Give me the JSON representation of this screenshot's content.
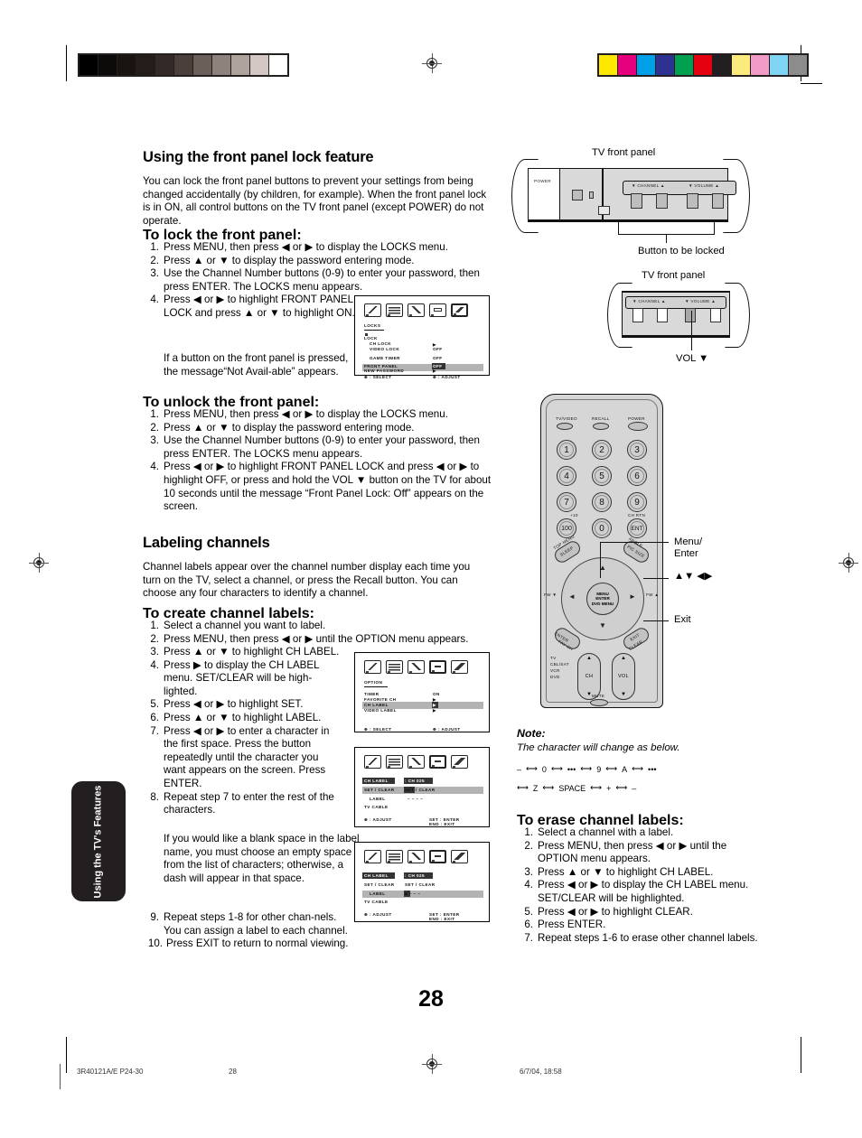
{
  "page": {
    "number": "28",
    "side_tab": "Using the TV's Features",
    "footer": {
      "code": "3R40121A/E P24-30",
      "page": "28",
      "date": "6/7/04, 18:58"
    }
  },
  "colors": {
    "grey_bars": [
      "#000000",
      "#0d0a0a",
      "#191312",
      "#241c1a",
      "#332926",
      "#4a3f3a",
      "#6b5f59",
      "#8d827c",
      "#aea49d",
      "#d3c8c3",
      "#ffffff"
    ],
    "color_bars": [
      "#ffe800",
      "#e6007e",
      "#00a0e9",
      "#2e3192",
      "#00a050",
      "#e3000f",
      "#231f20",
      "#fbea7d",
      "#f39bc8",
      "#7fd4f4",
      "#8c8c8c"
    ],
    "osd_highlight": "#b3b3b3",
    "panel_grey": "#d9d9d9"
  },
  "sections": {
    "front_panel_lock": {
      "heading": "Using the front panel lock feature",
      "intro": "You can lock the front panel buttons to prevent your settings from being changed accidentally (by children, for example). When the front panel lock is in ON, all control buttons on the TV front panel (except POWER) do not operate.",
      "lock_heading": "To lock the front panel:",
      "lock_steps": [
        "Press MENU, then press ◀ or ▶ to display the LOCKS menu.",
        "Press ▲ or ▼ to display the password entering mode.",
        "Use the Channel Number buttons (0-9) to enter your password, then press ENTER. The LOCKS menu appears.",
        "Press ◀ or ▶ to highlight FRONT PANEL LOCK and press ▲ or ▼ to highlight ON."
      ],
      "lock_note": "If a button on the front panel is pressed, the message“Not Avail-able” appears.",
      "unlock_heading": "To unlock the front panel:",
      "unlock_steps": [
        "Press MENU, then press ◀ or ▶ to display the LOCKS menu.",
        "Press ▲ or ▼ to display the password entering mode.",
        "Use the Channel Number buttons (0-9) to enter your password, then press ENTER. The LOCKS menu appears.",
        "Press ◀ or ▶ to highlight FRONT PANEL LOCK and press ◀ or ▶ to highlight OFF, or press and hold the VOL ▼ button on the TV for about 10 seconds until the message “Front Panel Lock: Off” appears on the screen."
      ]
    },
    "labeling_channels": {
      "heading": "Labeling channels",
      "intro": "Channel labels appear over the channel number display each time you turn on the TV, select a channel, or press the Recall button. You can choose any four characters to identify a channel.",
      "create_heading": "To create channel labels:",
      "create_steps": [
        "Select a channel you want to label.",
        "Press MENU, then press ◀ or ▶ until the OPTION menu appears.",
        "Press ▲ or ▼ to highlight CH LABEL.",
        "Press ▶ to display the CH LABEL menu. SET/CLEAR will be high-lighted.",
        "Press ◀ or ▶ to highlight SET.",
        "Press ▲ or ▼ to highlight LABEL.",
        "Press ◀ or ▶ to enter a character in the first space. Press the button repeatedly until the character you want appears on the screen. Press ENTER.",
        "Repeat step 7 to enter the rest of the characters.",
        "Repeat steps 1-8 for other chan-nels. You can assign a label to each channel.",
        "Press EXIT to return to normal viewing."
      ],
      "step8_note": "If you would like a blank space in the label name, you must choose an empty space from the list of characters; otherwise, a dash will appear in that space.",
      "erase_heading": "To erase channel labels:",
      "erase_steps": [
        "Select a channel with a label.",
        "Press MENU, then press ◀ or ▶ until the OPTION menu appears.",
        "Press ▲ or ▼ to highlight CH LABEL.",
        "Press ◀ or ▶ to display the CH LABEL menu. SET/CLEAR will be highlighted.",
        "Press ◀ or ▶ to highlight CLEAR.",
        "Press ENTER.",
        "Repeat steps 1-6 to erase other channel labels."
      ]
    },
    "note": {
      "title": "Note:",
      "text": "The character will change as below.",
      "sequence_row1": [
        "–",
        "0",
        "•••",
        "9",
        "A",
        "•••"
      ],
      "sequence_row2": [
        "Z",
        "SPACE",
        "+",
        "–"
      ]
    }
  },
  "figures": {
    "tv_panel_top": {
      "caption": "TV front panel",
      "power_label": "POWER",
      "channel_label": "▼ CHANNEL ▲",
      "volume_label": "▼ VOLUME ▲",
      "bracket_caption": "Button to be locked"
    },
    "tv_panel_bottom": {
      "caption": "TV front panel",
      "channel_label": "▼ CHANNEL ▲",
      "volume_label": "▼ VOLUME ▲",
      "pointer_label": "VOL ▼"
    },
    "remote": {
      "top_buttons": [
        "TV/VIDEO",
        "RECALL",
        "POWER"
      ],
      "keys": [
        "1",
        "2",
        "3",
        "4",
        "5",
        "6",
        "7",
        "8",
        "9",
        "100",
        "0",
        "ENT"
      ],
      "key_sub_100": "+10",
      "key_sub_ent": "CH RTN",
      "sleep_label": "SLEEP",
      "sleep_top": "TOP MENU",
      "pic_size_label": "PIC SIZE",
      "pic_size_top": "ANGLE",
      "fav_label": "FAV CH",
      "fav_top": "ENTER",
      "exit_label": "EXIT",
      "exit_sub": "CLEAR",
      "fw_left": "FW ▼",
      "fw_right": "FW ▲",
      "center": [
        "MENU",
        "ENTER",
        "DVD MENU"
      ],
      "mode_list": [
        "TV",
        "CBL/SAT",
        "VCR",
        "DVD"
      ],
      "ch_label": "CH",
      "vol_label": "VOL",
      "mute_label": "MUTE",
      "callouts": [
        "Menu/ Enter",
        "▲▼ ◀▶",
        "Exit"
      ],
      "callout_menu_line1": "Menu/",
      "callout_menu_line2": "Enter",
      "callout_arrows": "▲▼ ◀▶",
      "callout_exit": "Exit"
    }
  },
  "osd": {
    "locks": {
      "title": "LOCKS",
      "rows": [
        {
          "label": "LOCK",
          "value": ""
        },
        {
          "label": "CH LOCK",
          "value": "▶"
        },
        {
          "label": "VIDEO LOCK",
          "value": "OFF"
        },
        {
          "label": "GAME TIMER",
          "value": "OFF"
        },
        {
          "label": "FRONT PANEL",
          "value": "OFF"
        },
        {
          "label": "NEW PASSWORD",
          "value": "▶"
        }
      ],
      "footer_left": "⊕ : SELECT",
      "footer_right": "⊕ : ADJUST",
      "selected_icon_index": 4
    },
    "option": {
      "title": "OPTION",
      "rows": [
        {
          "label": "TIMER",
          "value": "ON"
        },
        {
          "label": "FAVORITE CH",
          "value": "▶"
        },
        {
          "label": "CH LABEL",
          "value": "▶"
        },
        {
          "label": "VIDEO LABEL",
          "value": "▶"
        }
      ],
      "footer_left": "⊕ : SELECT",
      "footer_right": "⊕ : ADJUST",
      "selected_icon_index": 3
    },
    "ch_label_set": {
      "title": "CH LABEL",
      "title_value": ": CH 025",
      "rows": [
        {
          "label": "SET / CLEAR",
          "value": "SET / CLEAR"
        },
        {
          "label": "LABEL",
          "value": "– – – –"
        },
        {
          "label": "TV CABLE",
          "value": ""
        }
      ],
      "footer_left": "⊕ : ADJUST",
      "footer_right_1": "SET : ENTER",
      "footer_right_2": "END : EXIT",
      "selected_icon_index": 3
    },
    "ch_label_label": {
      "title": "CH LABEL",
      "title_value": ": CH 025",
      "rows": [
        {
          "label": "SET / CLEAR",
          "value": "SET / CLEAR"
        },
        {
          "label": "LABEL",
          "value": "■ – – –"
        },
        {
          "label": "TV CABLE",
          "value": ""
        }
      ],
      "footer_left": "⊕ : ADJUST",
      "footer_right_1": "SET : ENTER",
      "footer_right_2": "END : EXIT",
      "selected_icon_index": 3
    }
  }
}
